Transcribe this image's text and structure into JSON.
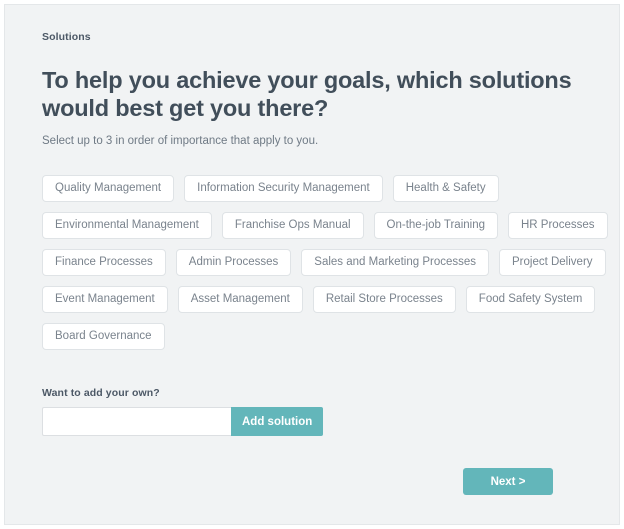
{
  "breadcrumb": "Solutions",
  "page": {
    "title": "To help you achieve your goals, which solutions would best get you there?",
    "subtitle": "Select up to 3 in order of importance that apply to you."
  },
  "colors": {
    "accent": "#63b6ba",
    "background": "#f1f3f4",
    "chip_background": "#ffffff",
    "chip_border": "#dfe3e6",
    "chip_text": "#7a838d",
    "heading_text": "#414e5a"
  },
  "solutions": {
    "rows": [
      [
        "Quality Management",
        "Information Security Management",
        "Health & Safety"
      ],
      [
        "Environmental Management",
        "Franchise Ops Manual",
        "On-the-job Training",
        "HR Processes"
      ],
      [
        "Finance Processes",
        "Admin Processes",
        "Sales and Marketing Processes",
        "Project Delivery"
      ],
      [
        "Event Management",
        "Asset Management",
        "Retail Store Processes",
        "Food Safety System"
      ],
      [
        "Board Governance"
      ]
    ]
  },
  "add_own": {
    "label": "Want to add your own?",
    "input_value": "",
    "input_placeholder": "",
    "button_label": "Add solution"
  },
  "footer": {
    "next_label": "Next >"
  }
}
